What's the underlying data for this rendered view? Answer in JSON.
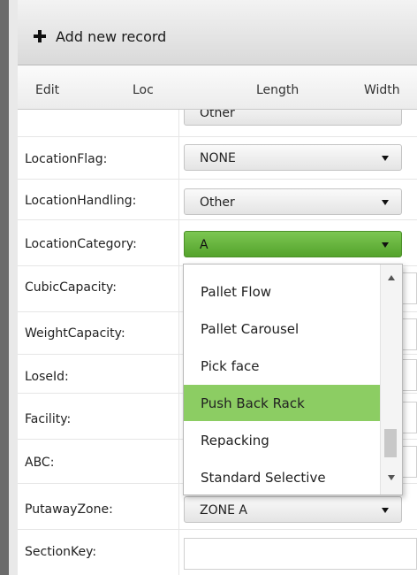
{
  "toolbar": {
    "add_label": "Add new record",
    "add_icon": "plus-icon"
  },
  "columns": [
    "Edit",
    "Loc",
    "Length",
    "Width"
  ],
  "form": {
    "partial_value": "Other",
    "location_flag": {
      "label": "LocationFlag:",
      "value": "NONE"
    },
    "location_handling": {
      "label": "LocationHandling:",
      "value": "Other"
    },
    "location_category": {
      "label": "LocationCategory:",
      "value": "A"
    },
    "cubic_capacity": {
      "label": "CubicCapacity:"
    },
    "weight_capacity": {
      "label": "WeightCapacity:"
    },
    "lose_id": {
      "label": "LoseId:"
    },
    "facility": {
      "label": "Facility:"
    },
    "abc": {
      "label": "ABC:"
    },
    "putaway_zone": {
      "label": "PutawayZone:",
      "value": "ZONE A"
    },
    "section_key": {
      "label": "SectionKey:"
    }
  },
  "dropdown": {
    "options": [
      "Pallet Flow",
      "Pallet Carousel",
      "Pick face",
      "Push Back Rack",
      "Repacking",
      "Standard Selective"
    ],
    "selected": "Push Back Rack"
  },
  "colors": {
    "accent_green": "#5aaa33",
    "highlight_green": "#8ccd63"
  }
}
